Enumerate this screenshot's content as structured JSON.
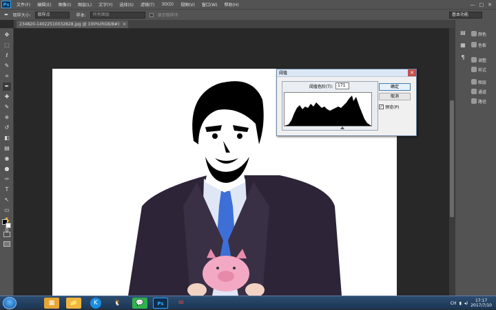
{
  "app": {
    "logo": "Ps"
  },
  "menu": [
    "文件(F)",
    "编辑(E)",
    "图像(I)",
    "图层(L)",
    "文字(Y)",
    "选择(S)",
    "滤镜(T)",
    "3D(D)",
    "视图(V)",
    "窗口(W)",
    "帮助(H)"
  ],
  "window_controls": [
    "—",
    "□",
    "✕"
  ],
  "options": {
    "sample_size_label": "取样大小:",
    "sample_size_value": "取样点",
    "sample_label": "样本:",
    "sample_value": "所有图层",
    "show_ring_label": "显示取样环",
    "workspace": "基本功能"
  },
  "document": {
    "tab_label": "234820-14022510032828.jpg @ 100%(RGB/8#)",
    "close": "×"
  },
  "tools": [
    "move-icon",
    "marquee-icon",
    "lasso-icon",
    "quick-select-icon",
    "crop-icon",
    "eyedropper-icon",
    "healing-icon",
    "brush-icon",
    "stamp-icon",
    "history-brush-icon",
    "eraser-icon",
    "gradient-icon",
    "blur-icon",
    "dodge-icon",
    "pen-icon",
    "type-icon",
    "path-select-icon",
    "shape-icon",
    "hand-icon",
    "zoom-icon"
  ],
  "tool_glyphs": [
    "✥",
    "⬚",
    "ℓ",
    "✎",
    "⌗",
    "✒",
    "✚",
    "✎",
    "⎈",
    "↺",
    "◧",
    "▤",
    "◉",
    "●",
    "✑",
    "T",
    "↖",
    "▭",
    "✋",
    "⚲"
  ],
  "panels": {
    "top": [
      {
        "label": "颜色"
      },
      {
        "label": "色板"
      }
    ],
    "mid": [
      {
        "label": "调整"
      },
      {
        "label": "样式"
      }
    ],
    "bottom": [
      {
        "label": "图层"
      },
      {
        "label": "通道"
      },
      {
        "label": "路径"
      }
    ]
  },
  "dialog": {
    "title": "阈值",
    "close": "✕",
    "threshold_label": "阈值色阶(T):",
    "threshold_value": "171",
    "ok_label": "确定",
    "cancel_label": "取消",
    "preview_label": "预览(P)",
    "preview_checked": "✓"
  },
  "taskbar": {
    "apps": [
      "file-manager-icon",
      "folder-icon",
      "browser-icon",
      "qq-icon",
      "wechat-icon",
      "photoshop-icon",
      "mail-icon"
    ],
    "app_glyphs": [
      "▦",
      "📁",
      "K",
      "🐧",
      "💬",
      "Ps",
      "✉"
    ],
    "tray_lang": "CH",
    "time": "17:17",
    "date": "2017/7/10"
  },
  "colors": {
    "ps_bg": "#535353",
    "canvas_bg": "#282828",
    "dialog_bg": "#f0f0f0",
    "taskbar": "#1c3553"
  }
}
